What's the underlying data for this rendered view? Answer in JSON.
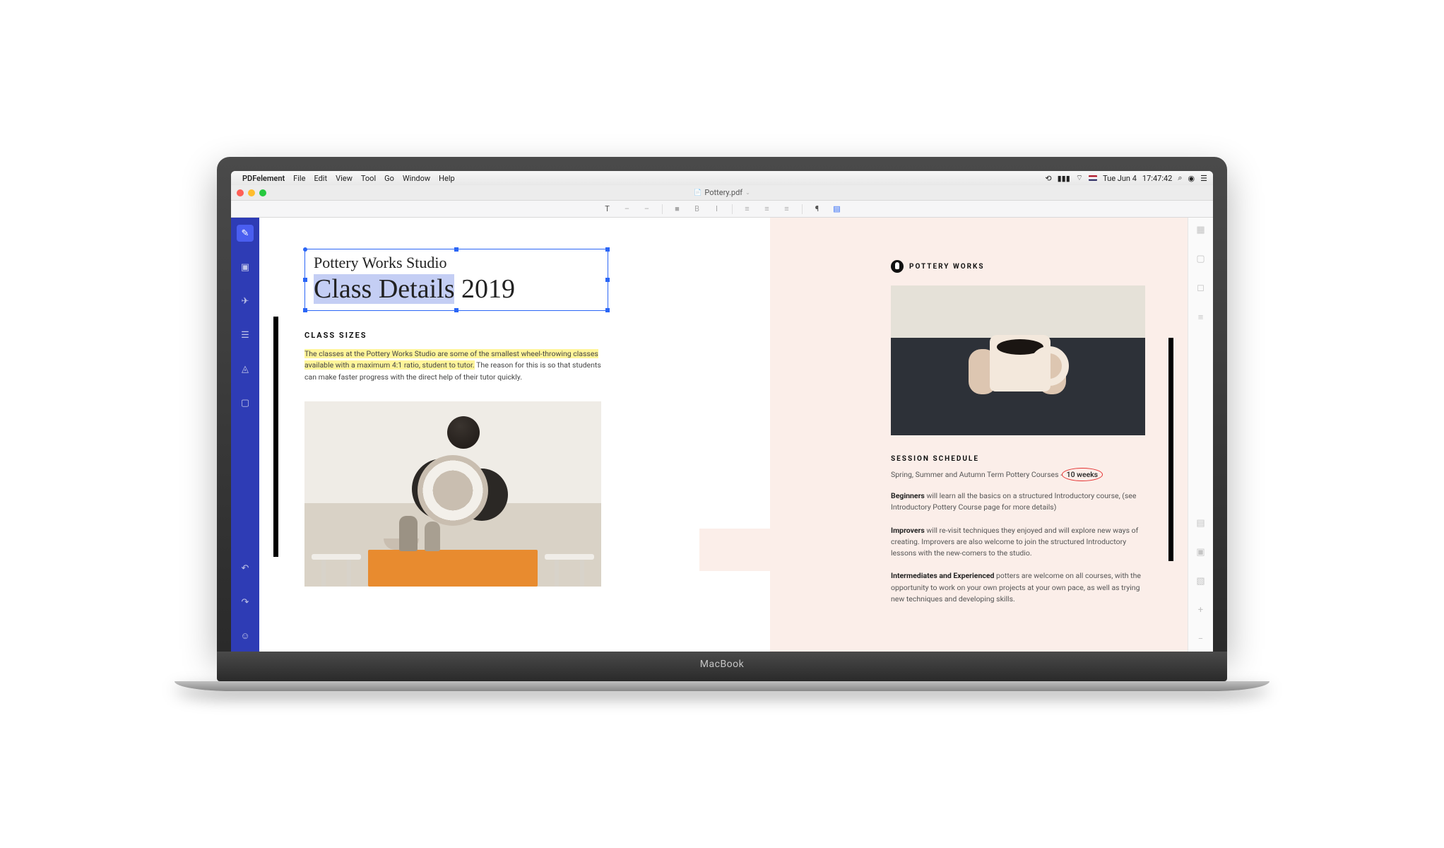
{
  "menubar": {
    "app": "PDFelement",
    "items": [
      "File",
      "Edit",
      "View",
      "Tool",
      "Go",
      "Window",
      "Help"
    ],
    "date": "Tue Jun 4",
    "time": "17:47:42"
  },
  "window": {
    "filename": "Pottery.pdf"
  },
  "document": {
    "studio_name": "Pottery Works Studio",
    "title_selected": "Class Details",
    "title_rest": " 2019",
    "brand": "POTTERY WORKS",
    "section1_hdr": "CLASS SIZES",
    "section1_highlight": "The classes at the Pottery Works Studio are some of the smallest wheel-throwing classes available with a maximum 4:1 ratio, student to tutor.",
    "section1_rest": " The reason for this is so that students can make faster progress with the direct help of their tutor quickly.",
    "section2_hdr": "SESSION SCHEDULE",
    "section2_line_pre": "Spring, Summer and Autumn Term Pottery Courses - ",
    "section2_circled": "10 weeks",
    "level1_bold": "Beginners",
    "level1_text": " will learn all the basics on a structured Introductory course, (see Introductory Pottery Course page for more details)",
    "level2_bold": "Improvers",
    "level2_text": " will re-visit techniques they enjoyed and will explore new ways of creating. Improvers are also welcome to join the structured Introductory lessons with the new-comers to the studio.",
    "level3_bold": "Intermediates and Experienced",
    "level3_text": " potters are welcome on all courses, with the opportunity to work on your own projects at your own pace, as well as trying new techniques and developing skills."
  },
  "laptop_brand": "MacBook"
}
